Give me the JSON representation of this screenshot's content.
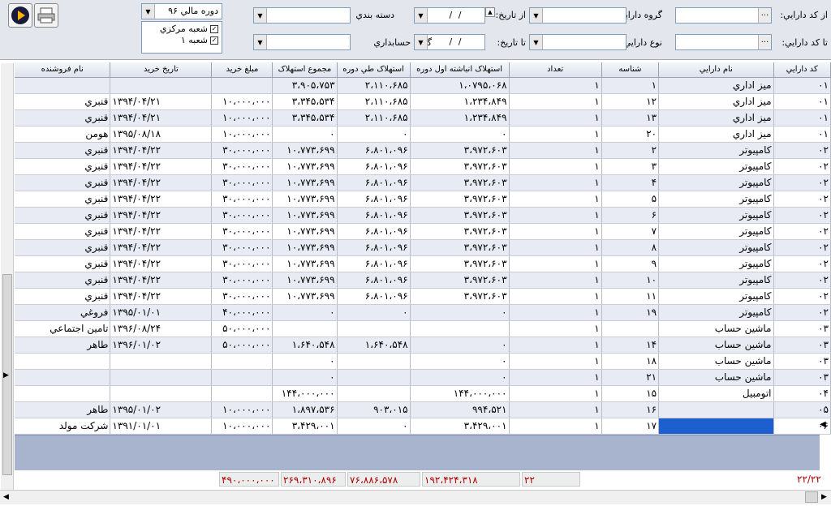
{
  "filters": {
    "from_asset_code_label": "از كد دارايي:",
    "to_asset_code_label": "تا كد دارايي:",
    "asset_group_label": "گروه دارايي",
    "asset_type_label": "نوع دارايي",
    "from_date_label": "از تاريخ:",
    "to_date_label": "تا تاريخ:",
    "category_label": "دسته بندي",
    "account_group_label": "گروه حسابداري",
    "date_placeholder": "/   /",
    "fiscal_period": "دوره مالي ۹۶",
    "branches": [
      "شعبه مرکزي",
      "شعبه ۱"
    ],
    "dots": "..."
  },
  "table": {
    "headers": [
      "كد دارايي",
      "نام دارايي",
      "شناسه",
      "تعداد",
      "استهلاک انباشته اول دوره",
      "استهلاک طي دوره",
      "مجموع استهلاک",
      "مبلغ خريد",
      "تاريخ خريد",
      "نام فروشنده"
    ],
    "rows": [
      [
        "۰۱",
        "ميز اداري",
        "۱",
        "۱",
        "۱،۰۷۹۵،۰۶۸",
        "۲،۱۱۰،۶۸۵",
        "۳،۹۰۵،۷۵۳",
        "",
        "",
        ""
      ],
      [
        "۰۱",
        "ميز اداري",
        "۱۲",
        "۱",
        "۱،۲۳۴،۸۴۹",
        "۲،۱۱۰،۶۸۵",
        "۳،۳۴۵،۵۳۴",
        "۱۰،۰۰۰،۰۰۰",
        "۱۳۹۴/۰۴/۲۱",
        "قنبري"
      ],
      [
        "۰۱",
        "ميز اداري",
        "۱۳",
        "۱",
        "۱،۲۳۴،۸۴۹",
        "۲،۱۱۰،۶۸۵",
        "۳،۳۴۵،۵۳۴",
        "۱۰،۰۰۰،۰۰۰",
        "۱۳۹۴/۰۴/۲۱",
        "قنبري"
      ],
      [
        "۰۱",
        "ميز اداري",
        "۲۰",
        "۱",
        "۰",
        "۰",
        "۰",
        "۱۰،۰۰۰،۰۰۰",
        "۱۳۹۵/۰۸/۱۸",
        "هومن"
      ],
      [
        "۰۲",
        "کامپيوتر",
        "۲",
        "۱",
        "۳،۹۷۲،۶۰۳",
        "۶،۸۰۱،۰۹۶",
        "۱۰،۷۷۳،۶۹۹",
        "۳۰،۰۰۰،۰۰۰",
        "۱۳۹۴/۰۴/۲۲",
        "قنبري"
      ],
      [
        "۰۲",
        "کامپيوتر",
        "۳",
        "۱",
        "۳،۹۷۲،۶۰۳",
        "۶،۸۰۱،۰۹۶",
        "۱۰،۷۷۳،۶۹۹",
        "۳۰،۰۰۰،۰۰۰",
        "۱۳۹۴/۰۴/۲۲",
        "قنبري"
      ],
      [
        "۰۲",
        "کامپيوتر",
        "۴",
        "۱",
        "۳،۹۷۲،۶۰۳",
        "۶،۸۰۱،۰۹۶",
        "۱۰،۷۷۳،۶۹۹",
        "۳۰،۰۰۰،۰۰۰",
        "۱۳۹۴/۰۴/۲۲",
        "قنبري"
      ],
      [
        "۰۲",
        "کامپيوتر",
        "۵",
        "۱",
        "۳،۹۷۲،۶۰۳",
        "۶،۸۰۱،۰۹۶",
        "۱۰،۷۷۳،۶۹۹",
        "۳۰،۰۰۰،۰۰۰",
        "۱۳۹۴/۰۴/۲۲",
        "قنبري"
      ],
      [
        "۰۲",
        "کامپيوتر",
        "۶",
        "۱",
        "۳،۹۷۲،۶۰۳",
        "۶،۸۰۱،۰۹۶",
        "۱۰،۷۷۳،۶۹۹",
        "۳۰،۰۰۰،۰۰۰",
        "۱۳۹۴/۰۴/۲۲",
        "قنبري"
      ],
      [
        "۰۲",
        "کامپيوتر",
        "۷",
        "۱",
        "۳،۹۷۲،۶۰۳",
        "۶،۸۰۱،۰۹۶",
        "۱۰،۷۷۳،۶۹۹",
        "۳۰،۰۰۰،۰۰۰",
        "۱۳۹۴/۰۴/۲۲",
        "قنبري"
      ],
      [
        "۰۲",
        "کامپيوتر",
        "۸",
        "۱",
        "۳،۹۷۲،۶۰۳",
        "۶،۸۰۱،۰۹۶",
        "۱۰،۷۷۳،۶۹۹",
        "۳۰،۰۰۰،۰۰۰",
        "۱۳۹۴/۰۴/۲۲",
        "قنبري"
      ],
      [
        "۰۲",
        "کامپيوتر",
        "۹",
        "۱",
        "۳،۹۷۲،۶۰۳",
        "۶،۸۰۱،۰۹۶",
        "۱۰،۷۷۳،۶۹۹",
        "۳۰،۰۰۰،۰۰۰",
        "۱۳۹۴/۰۴/۲۲",
        "قنبري"
      ],
      [
        "۰۲",
        "کامپيوتر",
        "۱۰",
        "۱",
        "۳،۹۷۲،۶۰۳",
        "۶،۸۰۱،۰۹۶",
        "۱۰،۷۷۳،۶۹۹",
        "۳۰،۰۰۰،۰۰۰",
        "۱۳۹۴/۰۴/۲۲",
        "قنبري"
      ],
      [
        "۰۲",
        "کامپيوتر",
        "۱۱",
        "۱",
        "۳،۹۷۲،۶۰۳",
        "۶،۸۰۱،۰۹۶",
        "۱۰،۷۷۳،۶۹۹",
        "۳۰،۰۰۰،۰۰۰",
        "۱۳۹۴/۰۴/۲۲",
        "قنبري"
      ],
      [
        "۰۲",
        "کامپيوتر",
        "۱۹",
        "۱",
        "۰",
        "۰",
        "۰",
        "۴۰،۰۰۰،۰۰۰",
        "۱۳۹۵/۰۱/۰۱",
        "فروغي"
      ],
      [
        "۰۳",
        "ماشين حساب",
        "",
        "۱",
        "",
        "",
        "",
        "۵۰،۰۰۰،۰۰۰",
        "۱۳۹۶/۰۸/۲۴",
        "تامين اجتماعي"
      ],
      [
        "۰۳",
        "ماشين حساب",
        "۱۴",
        "۱",
        "۰",
        "۱،۶۴۰،۵۴۸",
        "۱،۶۴۰،۵۴۸",
        "۵۰،۰۰۰،۰۰۰",
        "۱۳۹۶/۰۱/۰۲",
        "طاهر"
      ],
      [
        "۰۳",
        "ماشين حساب",
        "۱۸",
        "۱",
        "۰",
        "",
        "۰",
        "",
        "",
        ""
      ],
      [
        "۰۳",
        "ماشين حساب",
        "۲۱",
        "۱",
        "۰",
        "",
        "۰",
        "",
        "",
        ""
      ],
      [
        "۰۴",
        "اتومبيل",
        "۱۵",
        "۱",
        "۱۴۴،۰۰۰،۰۰۰",
        "",
        "۱۴۴،۰۰۰،۰۰۰",
        "",
        "",
        ""
      ],
      [
        "۰۵",
        "",
        "۱۶",
        "۱",
        "۹۹۴،۵۲۱",
        "۹۰۳،۰۱۵",
        "۱،۸۹۷،۵۳۶",
        "۱۰،۰۰۰،۰۰۰",
        "۱۳۹۵/۰۱/۰۲",
        "طاهر"
      ],
      [
        "۰۶",
        "",
        "۱۷",
        "۱",
        "۳،۴۲۹،۰۰۱",
        "۰",
        "۳،۴۲۹،۰۰۱",
        "۱۰،۰۰۰،۰۰۰",
        "۱۳۹۱/۰۱/۰۱",
        "شرکت مولد"
      ]
    ],
    "totals": {
      "record_count": "۲۲/۲۲",
      "quantity": "۲۲",
      "opening_dep": "۱۹۲،۴۲۴،۳۱۸",
      "period_dep": "۷۶،۸۸۶،۵۷۸",
      "total_dep": "۲۶۹،۳۱۰،۸۹۶",
      "purchase": "۴۹۰،۰۰۰،۰۰۰"
    }
  }
}
